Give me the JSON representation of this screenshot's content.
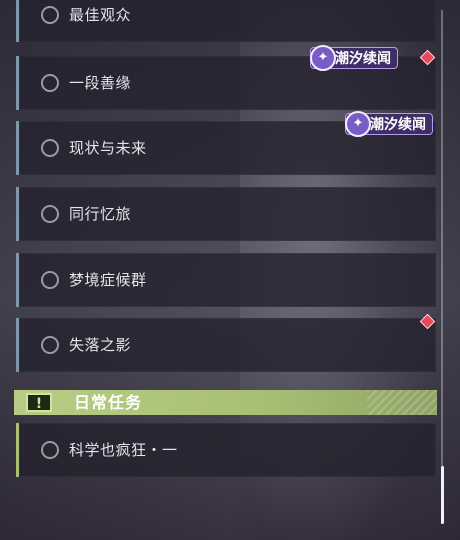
{
  "quests": [
    {
      "label": "最佳观众"
    },
    {
      "label": "一段善缘"
    },
    {
      "label": "现状与未来"
    },
    {
      "label": "同行忆旅"
    },
    {
      "label": "梦境症候群"
    },
    {
      "label": "失落之影"
    }
  ],
  "badges": [
    {
      "text": "潮汐续闻"
    },
    {
      "text": "潮汐续闻"
    }
  ],
  "daily_section": {
    "icon": "!",
    "title": "日常任务"
  },
  "daily_quests": [
    {
      "label": "科学也疯狂・一"
    }
  ],
  "colors": {
    "main_quest_bar": "#7f97a8",
    "daily_accent": "#a9bf72",
    "badge_bg": "#3d2f66",
    "alert_red": "#e64a5a"
  }
}
